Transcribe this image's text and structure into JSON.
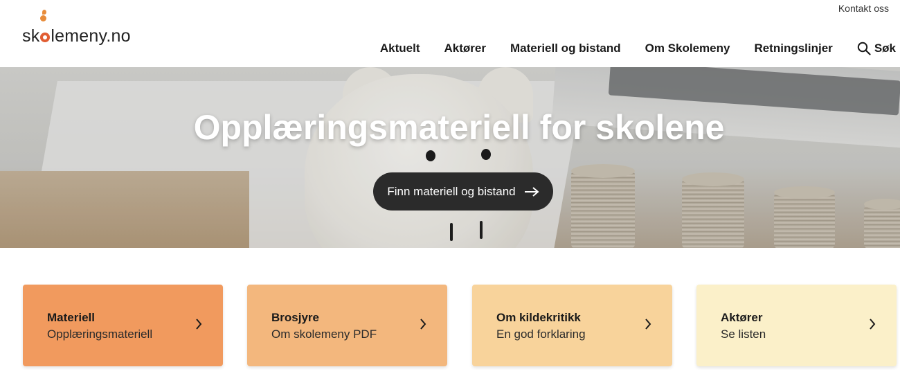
{
  "header": {
    "logo_text": "skolemeny.no",
    "contact_label": "Kontakt oss",
    "nav": [
      {
        "label": "Aktuelt"
      },
      {
        "label": "Aktører"
      },
      {
        "label": "Materiell og bistand"
      },
      {
        "label": "Om Skolemeny"
      },
      {
        "label": "Retningslinjer"
      },
      {
        "label": "Søk",
        "icon": "search-icon"
      }
    ]
  },
  "hero": {
    "title": "Opplæringsmateriell for skolene",
    "button_label": "Finn materiell og bistand",
    "button_icon": "arrow-right-icon"
  },
  "cards": [
    {
      "title": "Materiell",
      "subtitle": "Opplæringsmateriell",
      "color": "#f19a5e",
      "icon": "chevron-right-icon"
    },
    {
      "title": "Brosjyre",
      "subtitle": "Om skolemeny PDF",
      "color": "#f3b77d",
      "icon": "chevron-right-icon"
    },
    {
      "title": "Om kildekritikk",
      "subtitle": "En god forklaring",
      "color": "#f8d39b",
      "icon": "chevron-right-icon"
    },
    {
      "title": "Aktører",
      "subtitle": "Se listen",
      "color": "#fbf0c9",
      "icon": "chevron-right-icon"
    }
  ],
  "colors": {
    "logo_accent": "#e15d33",
    "button_bg": "#2b2b2b"
  }
}
